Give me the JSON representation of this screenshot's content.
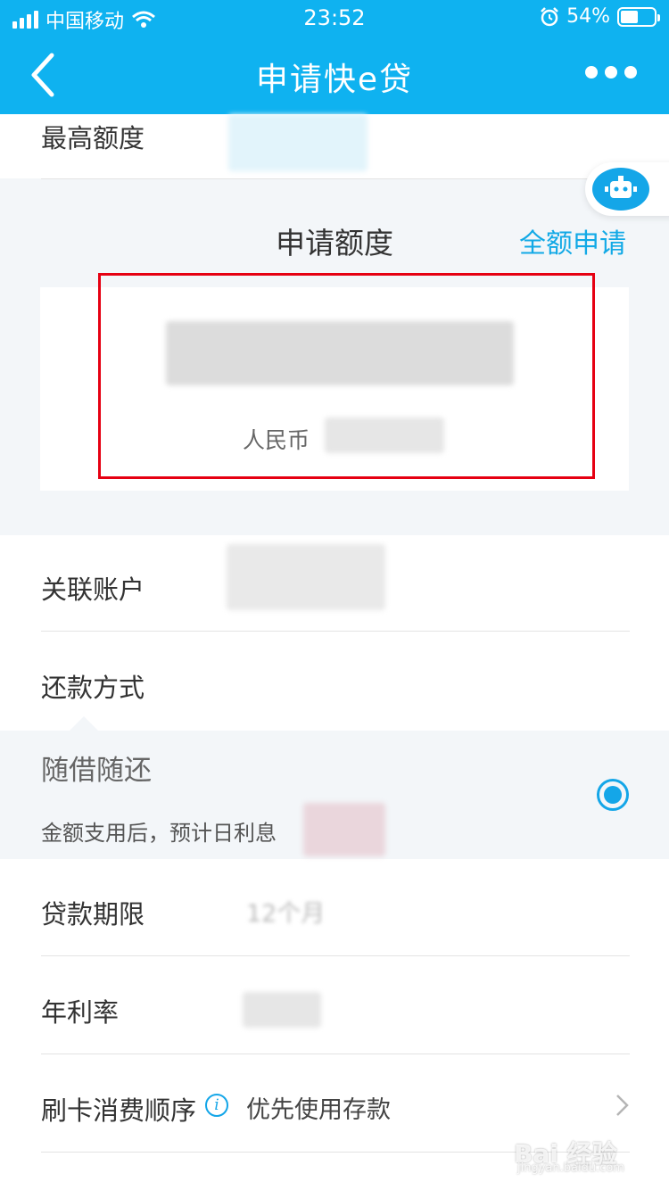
{
  "status_bar": {
    "carrier": "中国移动",
    "time": "23:52",
    "battery_percent": "54%",
    "battery_level": 0.54
  },
  "nav": {
    "title": "申请快e贷"
  },
  "fields": {
    "max_quota_label": "最高额度",
    "apply_quota_title": "申请额度",
    "full_apply_label": "全额申请",
    "currency_label": "人民币",
    "linked_account_label": "关联账户",
    "repay_method_label": "还款方式",
    "repay_option_label": "随借随还",
    "repay_option_desc": "金额支用后，预计日利息",
    "loan_term_label": "贷款期限",
    "loan_term_value": "12个月",
    "annual_rate_label": "年利率",
    "card_order_label": "刷卡消费顺序",
    "card_order_value": "优先使用存款"
  },
  "watermark": {
    "text": "Bai 经验",
    "url": "jingyan.baidu.com"
  },
  "colors": {
    "header": "#0fb2f0",
    "accent": "#14a6e8",
    "highlight_box": "#e60012"
  }
}
